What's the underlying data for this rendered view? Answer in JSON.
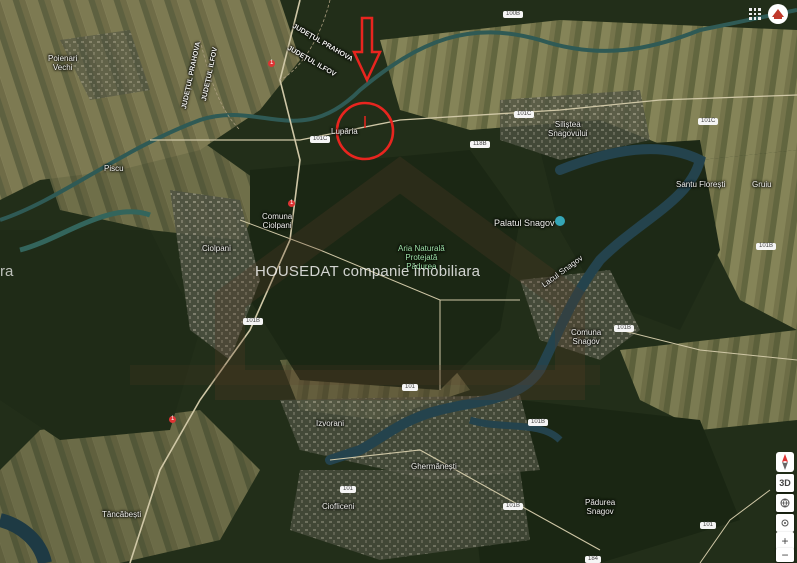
{
  "map": {
    "labels": {
      "judetul_prahova": "JUDEȚUL PRAHOVA",
      "judetul_ilfov_top": "JUDEȚUL ILFOV",
      "judetul_prahova_left": "JUDEȚUL PRAHOVA",
      "judetul_ilfov_left": "JUDEȚUL ILFOV",
      "poienari": "Poienari\nVechi",
      "lupăria": "Lupăria",
      "siliștea": "Siliștea\nSnagovului",
      "piscu": "Piscu",
      "comuna_ciolpani": "Comuna\nCiolpani",
      "ciolpani": "Ciolpani",
      "palatul": "Palatul Snagov",
      "aria": "Aria Naturală\nProtejată\nPădurea",
      "lacul": "Lacul Snagov",
      "santu": "Santu Florești",
      "gruiu": "Gruiu",
      "comuna_snagov": "Comuna\nSnagov",
      "izvorani": "Izvorani",
      "ghermanesti": "Ghermănești",
      "ciofliceni": "Ciofliceni",
      "tancabesti": "Tâncăbești",
      "padurea_snagov": "Pădurea\nSnagov"
    },
    "road_shields": {
      "r1": "1",
      "r1b": "1",
      "r1c": "1",
      "r101c_a": "101C",
      "r101c_b": "101C",
      "r101c_c": "101C",
      "r101b_a": "101B",
      "r101b_b": "101B",
      "r101b_c": "101B",
      "r101b_d": "101B",
      "r101b_e": "101B",
      "r101_a": "101",
      "r101_b": "101",
      "r101_c": "101",
      "r118b": "118B",
      "r100b": "100B",
      "r184": "184"
    },
    "watermark": "HOUSEDAT companie imobiliara",
    "watermark_left": "ra",
    "controls": {
      "three_d": "3D",
      "zoom_in": "+",
      "zoom_out": "−"
    },
    "marker": {
      "color": "#e8251f"
    },
    "colors": {
      "forest": "#26331c",
      "field": "#6b6a45",
      "water": "#2d5a64",
      "road": "#c9b98a"
    }
  }
}
